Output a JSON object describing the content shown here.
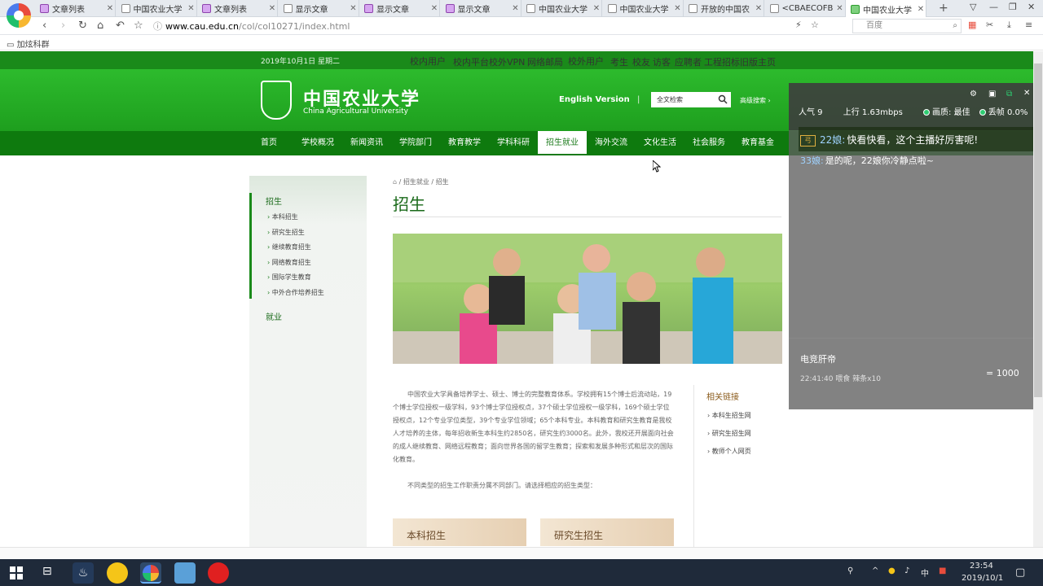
{
  "browser": {
    "tabs": [
      {
        "label": "文章列表",
        "icon": "purple-doc-icon"
      },
      {
        "label": "中国农业大学",
        "icon": "page-icon"
      },
      {
        "label": "文章列表",
        "icon": "purple-doc-icon"
      },
      {
        "label": "显示文章",
        "icon": "page-icon"
      },
      {
        "label": "显示文章",
        "icon": "purple-doc-icon"
      },
      {
        "label": "显示文章",
        "icon": "purple-doc-icon"
      },
      {
        "label": "中国农业大学",
        "icon": "page-icon"
      },
      {
        "label": "中国农业大学",
        "icon": "page-icon"
      },
      {
        "label": "开放的中国农",
        "icon": "page-icon"
      },
      {
        "label": "<CBAECOFB",
        "icon": "page-icon"
      },
      {
        "label": "中国农业大学",
        "icon": "green-page-icon",
        "active": true
      }
    ],
    "address": {
      "domain": "www.cau.edu.cn",
      "path": "/col/col10271/index.html"
    },
    "search_placeholder": "百度",
    "bookmark": "加炫科群"
  },
  "site": {
    "date": "2019年10月1日 星期二",
    "top_links": [
      "校内用户",
      "校内平台",
      "校外VPN",
      "网络邮局",
      "校外用户",
      "考生",
      "校友",
      "访客",
      "应聘者",
      "工程招标",
      "旧版主页"
    ],
    "name_cn": "中国农业大学",
    "name_en": "China Agricultural University",
    "english_version": "English Version",
    "separator": "|",
    "search_placeholder": "全文检索",
    "advanced_search": "高级搜索 ›",
    "menu": [
      "首页",
      "学校概况",
      "新闻资讯",
      "学院部门",
      "教育教学",
      "学科科研",
      "招生就业",
      "海外交流",
      "文化生活",
      "社会服务",
      "教育基金"
    ],
    "menu_active": "招生就业"
  },
  "sidebar": {
    "title": "招生",
    "items": [
      "本科招生",
      "研究生招生",
      "继续教育招生",
      "网络教育招生",
      "国际学生教育",
      "中外合作培养招生"
    ],
    "job": "就业"
  },
  "main": {
    "breadcrumb": [
      "招生就业",
      "招生"
    ],
    "title": "招生",
    "intro_1": "中国农业大学具备培养学士、硕士、博士的完整教育体系。学校拥有15个博士后流动站，19个博士学位授权一级学科，93个博士学位授权点，37个硕士学位授权一级学科，169个硕士学位授权点，12个专业学位类型，39个专业学位领域；65个本科专业。本科教育和研究生教育是我校人才培养的主体，每年招收新生本科生约2850名，研究生约3000名。此外，我校还开展面向社会的成人继续教育、网络远程教育；面向世界各国的留学生教育；探索和发展多种形式和层次的国际化教育。",
    "intro_2": "不同类型的招生工作职责分属不同部门。请选择相应的招生类型：",
    "categories": [
      "本科招生",
      "研究生招生"
    ]
  },
  "related": {
    "title": "相关链接",
    "items": [
      "本科生招生网",
      "研究生招生网",
      "教师个人网页"
    ]
  },
  "overlay": {
    "popularity": "人气 9",
    "upload": "上行 1.63mbps",
    "quality": "画质: 最佳",
    "drop": "丢帧 0.0%",
    "msg1_level": "弓",
    "msg1_nick": "22娘:",
    "msg1_text": "快看快看，这个主播好厉害呢!",
    "msg2_nick": "33娘:",
    "msg2_text": "是的呢，22娘你冷静点啦~",
    "game": "电竞肝帝",
    "sub": "22:41:40  喂食  辣条x10",
    "right": "=  1000"
  },
  "taskbar": {
    "time": "23:54",
    "date": "2019/10/1",
    "ime": "中"
  }
}
